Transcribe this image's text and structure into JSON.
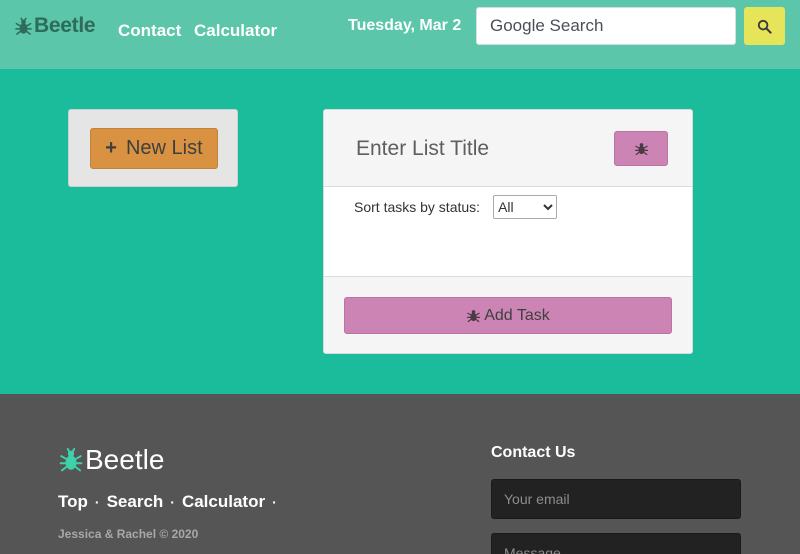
{
  "colors": {
    "navbar": "#5bc6a9",
    "page_bg": "#1abc9c",
    "new_list_button": "#d99242",
    "pink_button": "#cc84b5",
    "search_button": "#e6e55a",
    "footer_bg": "#555555"
  },
  "nav": {
    "brand": "Beetle",
    "brand_icon": "beetle-icon",
    "links": [
      "Contact",
      "Calculator"
    ],
    "date": "Tuesday, Mar 2",
    "search_placeholder": "Google Search",
    "search_icon": "search-icon"
  },
  "sidebar": {
    "new_list_label": "New List",
    "new_list_icon": "plus-icon"
  },
  "list": {
    "title_placeholder": "Enter List Title",
    "delete_icon": "beetle-icon",
    "sort_label": "Sort tasks by status:",
    "sort_selected": "All",
    "add_task_label": "Add Task",
    "add_task_icon": "beetle-icon"
  },
  "footer": {
    "brand": "Beetle",
    "brand_icon": "beetle-icon",
    "links": [
      "Top",
      "Search",
      "Calculator"
    ],
    "copyright": "Jessica & Rachel © 2020",
    "contact_title": "Contact Us",
    "email_placeholder": "Your email",
    "message_placeholder": "Message"
  }
}
